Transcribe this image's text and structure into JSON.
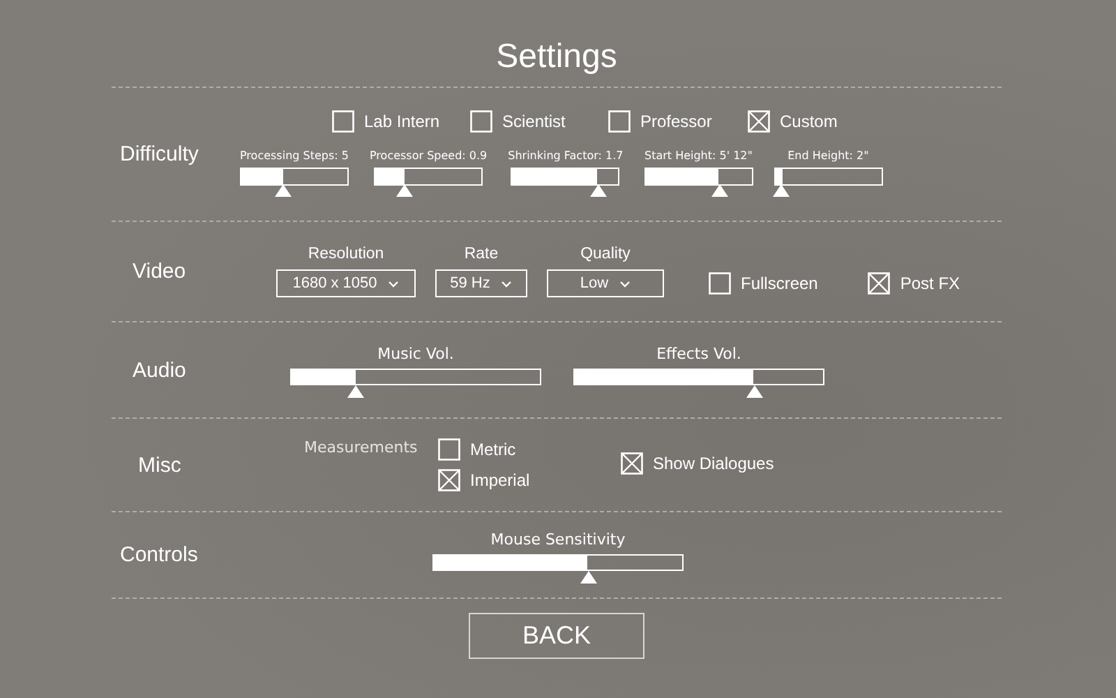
{
  "title": "Settings",
  "sections": [
    {
      "kind": "difficulty",
      "label": "Difficulty",
      "presets": [
        {
          "label": "Lab Intern",
          "checked": false
        },
        {
          "label": "Scientist",
          "checked": false
        },
        {
          "label": "Professor",
          "checked": false
        },
        {
          "label": "Custom",
          "checked": true
        }
      ],
      "sliders": [
        {
          "label": "Processing Steps: 5",
          "level": 0.4
        },
        {
          "label": "Processor Speed: 0.9",
          "level": 0.28
        },
        {
          "label": "Shrinking Factor: 1.7",
          "level": 0.8
        },
        {
          "label": "Start Height: 5' 12\"",
          "level": 0.69
        },
        {
          "label": "End Height: 2\"",
          "level": 0.07
        }
      ]
    },
    {
      "kind": "video",
      "label": "Video",
      "dropdowns": [
        {
          "label": "Resolution",
          "value": "1680 x 1050"
        },
        {
          "label": "Rate",
          "value": "59 Hz"
        },
        {
          "label": "Quality",
          "value": "Low"
        }
      ],
      "options": [
        {
          "label": "Fullscreen",
          "checked": false
        },
        {
          "label": "Post FX",
          "checked": true
        }
      ]
    },
    {
      "kind": "audio",
      "label": "Audio",
      "sliders": [
        {
          "label": "Music Vol.",
          "level": 0.26
        },
        {
          "label": "Effects Vol.",
          "level": 0.72
        }
      ]
    },
    {
      "kind": "misc",
      "label": "Misc",
      "group_label": "Measurements",
      "units": [
        {
          "label": "Metric",
          "selected": false
        },
        {
          "label": "Imperial",
          "selected": true
        }
      ],
      "options": [
        {
          "label": "Show Dialogues",
          "checked": true
        }
      ]
    },
    {
      "kind": "controls",
      "label": "Controls",
      "sliders": [
        {
          "label": "Mouse Sensitivity",
          "level": 0.62
        }
      ]
    }
  ],
  "back_button": "BACK"
}
